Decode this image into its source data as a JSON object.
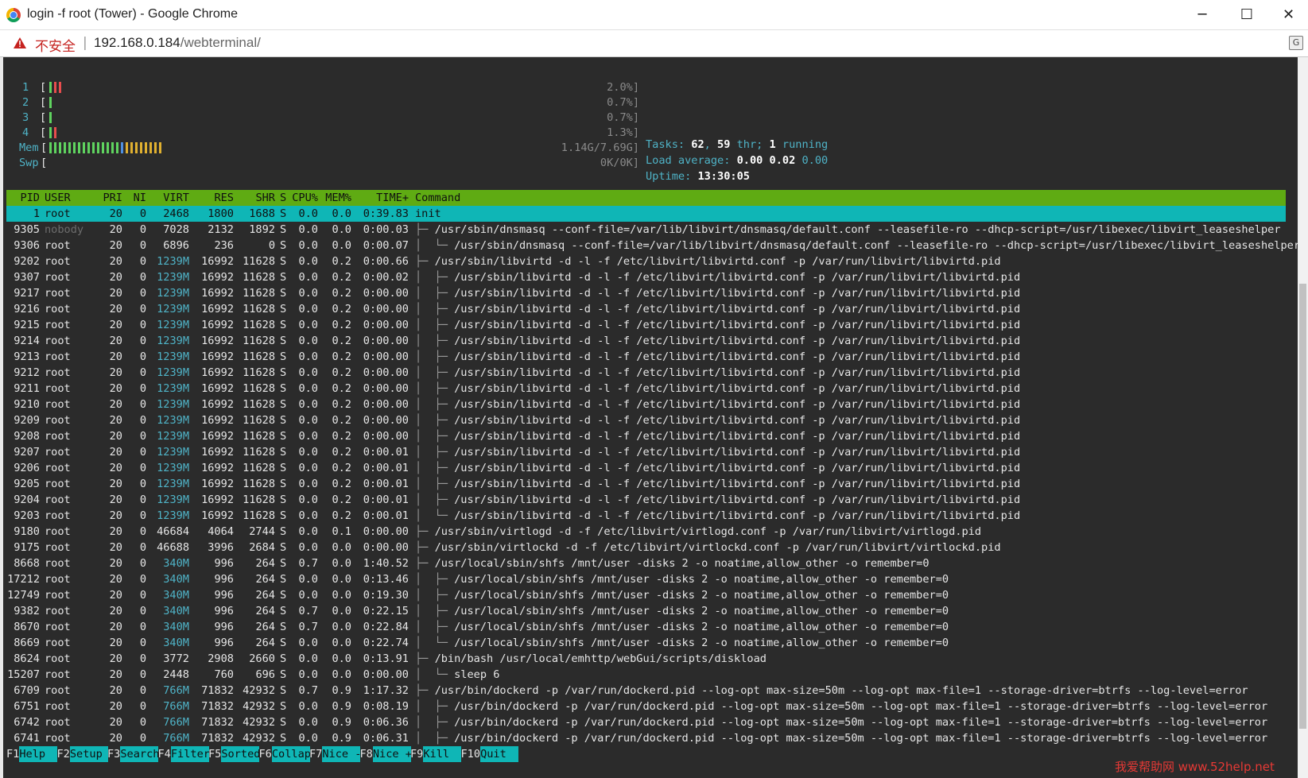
{
  "window": {
    "title": "login -f root (Tower) - Google Chrome",
    "min_glyph": "─",
    "max_glyph": "☐",
    "close_glyph": "✕"
  },
  "address": {
    "security_label": "不安全",
    "separator": "|",
    "host": "192.168.0.184",
    "path": "/webterminal/"
  },
  "translate_icon": "icon-translate",
  "meters": [
    {
      "label": "1",
      "value": "2.0%]",
      "segments": [
        "#5fd35f",
        "#e84d4d",
        "#e84d4d"
      ]
    },
    {
      "label": "2",
      "value": "0.7%]",
      "segments": [
        "#5fd35f"
      ]
    },
    {
      "label": "3",
      "value": "0.7%]",
      "segments": [
        "#5fd35f"
      ]
    },
    {
      "label": "4",
      "value": "1.3%]",
      "segments": [
        "#5fd35f",
        "#e84d4d"
      ]
    },
    {
      "label": "Mem",
      "value": "1.14G/7.69G]",
      "segments": [
        "#5fd35f",
        "#5fd35f",
        "#5fd35f",
        "#5fd35f",
        "#5fd35f",
        "#5fd35f",
        "#5fd35f",
        "#5fd35f",
        "#5fd35f",
        "#5fd35f",
        "#5fd35f",
        "#5fd35f",
        "#5fd35f",
        "#5fd35f",
        "#5fd35f",
        "#4f8fe0",
        "#e0b030",
        "#e0b030",
        "#e0b030",
        "#e0b030",
        "#e0b030",
        "#e0b030",
        "#e0b030",
        "#e0b030"
      ]
    },
    {
      "label": "Swp",
      "value": "0K/0K]",
      "segments": []
    }
  ],
  "summary": {
    "tasks_label": "Tasks:",
    "tasks": "62",
    "thr": "59",
    "thr_label": "thr;",
    "running": "1",
    "running_label": "running",
    "load_label": "Load average:",
    "load1": "0.00",
    "load5": "0.02",
    "load15": "0.00",
    "uptime_label": "Uptime:",
    "uptime": "13:30:05"
  },
  "header": {
    "pid": "PID",
    "user": "USER",
    "pri": "PRI",
    "ni": "NI",
    "virt": "VIRT",
    "res": "RES",
    "shr": "SHR",
    "s": "S",
    "cpu": "CPU%",
    "mem": "MEM%",
    "time": "TIME+",
    "cmd": "Command"
  },
  "processes": [
    {
      "pid": "1",
      "user": "root",
      "pri": "20",
      "ni": "0",
      "virt": "2468",
      "res": "1800",
      "shr": "1688",
      "s": "S",
      "cpu": "0.0",
      "mem": "0.0",
      "time": "0:39.83",
      "tree": "",
      "cmd": "init",
      "selected": true
    },
    {
      "pid": "9305",
      "user": "nobody",
      "pri": "20",
      "ni": "0",
      "virt": "7028",
      "res": "2132",
      "shr": "1892",
      "s": "S",
      "cpu": "0.0",
      "mem": "0.0",
      "time": "0:00.03",
      "tree": "├─ ",
      "cmd": "/usr/sbin/dnsmasq --conf-file=/var/lib/libvirt/dnsmasq/default.conf --leasefile-ro --dhcp-script=/usr/libexec/libvirt_leaseshelper"
    },
    {
      "pid": "9306",
      "user": "root",
      "pri": "20",
      "ni": "0",
      "virt": "6896",
      "res": "236",
      "shr": "0",
      "s": "S",
      "cpu": "0.0",
      "mem": "0.0",
      "time": "0:00.07",
      "tree": "│  └─ ",
      "cmd": "/usr/sbin/dnsmasq --conf-file=/var/lib/libvirt/dnsmasq/default.conf --leasefile-ro --dhcp-script=/usr/libexec/libvirt_leaseshelper"
    },
    {
      "pid": "9202",
      "user": "root",
      "pri": "20",
      "ni": "0",
      "virt": "1239M",
      "res": "16992",
      "shr": "11628",
      "s": "S",
      "cpu": "0.0",
      "mem": "0.2",
      "time": "0:00.66",
      "tree": "├─ ",
      "cmd": "/usr/sbin/libvirtd -d -l -f /etc/libvirt/libvirtd.conf -p /var/run/libvirt/libvirtd.pid"
    },
    {
      "pid": "9307",
      "user": "root",
      "pri": "20",
      "ni": "0",
      "virt": "1239M",
      "res": "16992",
      "shr": "11628",
      "s": "S",
      "cpu": "0.0",
      "mem": "0.2",
      "time": "0:00.02",
      "tree": "│  ├─ ",
      "cmd": "/usr/sbin/libvirtd -d -l -f /etc/libvirt/libvirtd.conf -p /var/run/libvirt/libvirtd.pid"
    },
    {
      "pid": "9217",
      "user": "root",
      "pri": "20",
      "ni": "0",
      "virt": "1239M",
      "res": "16992",
      "shr": "11628",
      "s": "S",
      "cpu": "0.0",
      "mem": "0.2",
      "time": "0:00.00",
      "tree": "│  ├─ ",
      "cmd": "/usr/sbin/libvirtd -d -l -f /etc/libvirt/libvirtd.conf -p /var/run/libvirt/libvirtd.pid"
    },
    {
      "pid": "9216",
      "user": "root",
      "pri": "20",
      "ni": "0",
      "virt": "1239M",
      "res": "16992",
      "shr": "11628",
      "s": "S",
      "cpu": "0.0",
      "mem": "0.2",
      "time": "0:00.00",
      "tree": "│  ├─ ",
      "cmd": "/usr/sbin/libvirtd -d -l -f /etc/libvirt/libvirtd.conf -p /var/run/libvirt/libvirtd.pid"
    },
    {
      "pid": "9215",
      "user": "root",
      "pri": "20",
      "ni": "0",
      "virt": "1239M",
      "res": "16992",
      "shr": "11628",
      "s": "S",
      "cpu": "0.0",
      "mem": "0.2",
      "time": "0:00.00",
      "tree": "│  ├─ ",
      "cmd": "/usr/sbin/libvirtd -d -l -f /etc/libvirt/libvirtd.conf -p /var/run/libvirt/libvirtd.pid"
    },
    {
      "pid": "9214",
      "user": "root",
      "pri": "20",
      "ni": "0",
      "virt": "1239M",
      "res": "16992",
      "shr": "11628",
      "s": "S",
      "cpu": "0.0",
      "mem": "0.2",
      "time": "0:00.00",
      "tree": "│  ├─ ",
      "cmd": "/usr/sbin/libvirtd -d -l -f /etc/libvirt/libvirtd.conf -p /var/run/libvirt/libvirtd.pid"
    },
    {
      "pid": "9213",
      "user": "root",
      "pri": "20",
      "ni": "0",
      "virt": "1239M",
      "res": "16992",
      "shr": "11628",
      "s": "S",
      "cpu": "0.0",
      "mem": "0.2",
      "time": "0:00.00",
      "tree": "│  ├─ ",
      "cmd": "/usr/sbin/libvirtd -d -l -f /etc/libvirt/libvirtd.conf -p /var/run/libvirt/libvirtd.pid"
    },
    {
      "pid": "9212",
      "user": "root",
      "pri": "20",
      "ni": "0",
      "virt": "1239M",
      "res": "16992",
      "shr": "11628",
      "s": "S",
      "cpu": "0.0",
      "mem": "0.2",
      "time": "0:00.00",
      "tree": "│  ├─ ",
      "cmd": "/usr/sbin/libvirtd -d -l -f /etc/libvirt/libvirtd.conf -p /var/run/libvirt/libvirtd.pid"
    },
    {
      "pid": "9211",
      "user": "root",
      "pri": "20",
      "ni": "0",
      "virt": "1239M",
      "res": "16992",
      "shr": "11628",
      "s": "S",
      "cpu": "0.0",
      "mem": "0.2",
      "time": "0:00.00",
      "tree": "│  ├─ ",
      "cmd": "/usr/sbin/libvirtd -d -l -f /etc/libvirt/libvirtd.conf -p /var/run/libvirt/libvirtd.pid"
    },
    {
      "pid": "9210",
      "user": "root",
      "pri": "20",
      "ni": "0",
      "virt": "1239M",
      "res": "16992",
      "shr": "11628",
      "s": "S",
      "cpu": "0.0",
      "mem": "0.2",
      "time": "0:00.00",
      "tree": "│  ├─ ",
      "cmd": "/usr/sbin/libvirtd -d -l -f /etc/libvirt/libvirtd.conf -p /var/run/libvirt/libvirtd.pid"
    },
    {
      "pid": "9209",
      "user": "root",
      "pri": "20",
      "ni": "0",
      "virt": "1239M",
      "res": "16992",
      "shr": "11628",
      "s": "S",
      "cpu": "0.0",
      "mem": "0.2",
      "time": "0:00.00",
      "tree": "│  ├─ ",
      "cmd": "/usr/sbin/libvirtd -d -l -f /etc/libvirt/libvirtd.conf -p /var/run/libvirt/libvirtd.pid"
    },
    {
      "pid": "9208",
      "user": "root",
      "pri": "20",
      "ni": "0",
      "virt": "1239M",
      "res": "16992",
      "shr": "11628",
      "s": "S",
      "cpu": "0.0",
      "mem": "0.2",
      "time": "0:00.00",
      "tree": "│  ├─ ",
      "cmd": "/usr/sbin/libvirtd -d -l -f /etc/libvirt/libvirtd.conf -p /var/run/libvirt/libvirtd.pid"
    },
    {
      "pid": "9207",
      "user": "root",
      "pri": "20",
      "ni": "0",
      "virt": "1239M",
      "res": "16992",
      "shr": "11628",
      "s": "S",
      "cpu": "0.0",
      "mem": "0.2",
      "time": "0:00.01",
      "tree": "│  ├─ ",
      "cmd": "/usr/sbin/libvirtd -d -l -f /etc/libvirt/libvirtd.conf -p /var/run/libvirt/libvirtd.pid"
    },
    {
      "pid": "9206",
      "user": "root",
      "pri": "20",
      "ni": "0",
      "virt": "1239M",
      "res": "16992",
      "shr": "11628",
      "s": "S",
      "cpu": "0.0",
      "mem": "0.2",
      "time": "0:00.01",
      "tree": "│  ├─ ",
      "cmd": "/usr/sbin/libvirtd -d -l -f /etc/libvirt/libvirtd.conf -p /var/run/libvirt/libvirtd.pid"
    },
    {
      "pid": "9205",
      "user": "root",
      "pri": "20",
      "ni": "0",
      "virt": "1239M",
      "res": "16992",
      "shr": "11628",
      "s": "S",
      "cpu": "0.0",
      "mem": "0.2",
      "time": "0:00.01",
      "tree": "│  ├─ ",
      "cmd": "/usr/sbin/libvirtd -d -l -f /etc/libvirt/libvirtd.conf -p /var/run/libvirt/libvirtd.pid"
    },
    {
      "pid": "9204",
      "user": "root",
      "pri": "20",
      "ni": "0",
      "virt": "1239M",
      "res": "16992",
      "shr": "11628",
      "s": "S",
      "cpu": "0.0",
      "mem": "0.2",
      "time": "0:00.01",
      "tree": "│  ├─ ",
      "cmd": "/usr/sbin/libvirtd -d -l -f /etc/libvirt/libvirtd.conf -p /var/run/libvirt/libvirtd.pid"
    },
    {
      "pid": "9203",
      "user": "root",
      "pri": "20",
      "ni": "0",
      "virt": "1239M",
      "res": "16992",
      "shr": "11628",
      "s": "S",
      "cpu": "0.0",
      "mem": "0.2",
      "time": "0:00.01",
      "tree": "│  └─ ",
      "cmd": "/usr/sbin/libvirtd -d -l -f /etc/libvirt/libvirtd.conf -p /var/run/libvirt/libvirtd.pid"
    },
    {
      "pid": "9180",
      "user": "root",
      "pri": "20",
      "ni": "0",
      "virt": "46684",
      "res": "4064",
      "shr": "2744",
      "s": "S",
      "cpu": "0.0",
      "mem": "0.1",
      "time": "0:00.00",
      "tree": "├─ ",
      "cmd": "/usr/sbin/virtlogd -d -f /etc/libvirt/virtlogd.conf -p /var/run/libvirt/virtlogd.pid"
    },
    {
      "pid": "9175",
      "user": "root",
      "pri": "20",
      "ni": "0",
      "virt": "46688",
      "res": "3996",
      "shr": "2684",
      "s": "S",
      "cpu": "0.0",
      "mem": "0.0",
      "time": "0:00.00",
      "tree": "├─ ",
      "cmd": "/usr/sbin/virtlockd -d -f /etc/libvirt/virtlockd.conf -p /var/run/libvirt/virtlockd.pid"
    },
    {
      "pid": "8668",
      "user": "root",
      "pri": "20",
      "ni": "0",
      "virt": "340M",
      "res": "996",
      "shr": "264",
      "s": "S",
      "cpu": "0.7",
      "mem": "0.0",
      "time": "1:40.52",
      "tree": "├─ ",
      "cmd": "/usr/local/sbin/shfs /mnt/user -disks 2 -o noatime,allow_other -o remember=0"
    },
    {
      "pid": "17212",
      "user": "root",
      "pri": "20",
      "ni": "0",
      "virt": "340M",
      "res": "996",
      "shr": "264",
      "s": "S",
      "cpu": "0.0",
      "mem": "0.0",
      "time": "0:13.46",
      "tree": "│  ├─ ",
      "cmd": "/usr/local/sbin/shfs /mnt/user -disks 2 -o noatime,allow_other -o remember=0"
    },
    {
      "pid": "12749",
      "user": "root",
      "pri": "20",
      "ni": "0",
      "virt": "340M",
      "res": "996",
      "shr": "264",
      "s": "S",
      "cpu": "0.0",
      "mem": "0.0",
      "time": "0:19.30",
      "tree": "│  ├─ ",
      "cmd": "/usr/local/sbin/shfs /mnt/user -disks 2 -o noatime,allow_other -o remember=0"
    },
    {
      "pid": "9382",
      "user": "root",
      "pri": "20",
      "ni": "0",
      "virt": "340M",
      "res": "996",
      "shr": "264",
      "s": "S",
      "cpu": "0.7",
      "mem": "0.0",
      "time": "0:22.15",
      "tree": "│  ├─ ",
      "cmd": "/usr/local/sbin/shfs /mnt/user -disks 2 -o noatime,allow_other -o remember=0"
    },
    {
      "pid": "8670",
      "user": "root",
      "pri": "20",
      "ni": "0",
      "virt": "340M",
      "res": "996",
      "shr": "264",
      "s": "S",
      "cpu": "0.7",
      "mem": "0.0",
      "time": "0:22.84",
      "tree": "│  ├─ ",
      "cmd": "/usr/local/sbin/shfs /mnt/user -disks 2 -o noatime,allow_other -o remember=0"
    },
    {
      "pid": "8669",
      "user": "root",
      "pri": "20",
      "ni": "0",
      "virt": "340M",
      "res": "996",
      "shr": "264",
      "s": "S",
      "cpu": "0.0",
      "mem": "0.0",
      "time": "0:22.74",
      "tree": "│  └─ ",
      "cmd": "/usr/local/sbin/shfs /mnt/user -disks 2 -o noatime,allow_other -o remember=0"
    },
    {
      "pid": "8624",
      "user": "root",
      "pri": "20",
      "ni": "0",
      "virt": "3772",
      "res": "2908",
      "shr": "2660",
      "s": "S",
      "cpu": "0.0",
      "mem": "0.0",
      "time": "0:13.91",
      "tree": "├─ ",
      "cmd": "/bin/bash /usr/local/emhttp/webGui/scripts/diskload"
    },
    {
      "pid": "15207",
      "user": "root",
      "pri": "20",
      "ni": "0",
      "virt": "2448",
      "res": "760",
      "shr": "696",
      "s": "S",
      "cpu": "0.0",
      "mem": "0.0",
      "time": "0:00.00",
      "tree": "│  └─ ",
      "cmd": "sleep 6"
    },
    {
      "pid": "6709",
      "user": "root",
      "pri": "20",
      "ni": "0",
      "virt": "766M",
      "res": "71832",
      "shr": "42932",
      "s": "S",
      "cpu": "0.7",
      "mem": "0.9",
      "time": "1:17.32",
      "tree": "├─ ",
      "cmd": "/usr/bin/dockerd -p /var/run/dockerd.pid --log-opt max-size=50m --log-opt max-file=1 --storage-driver=btrfs --log-level=error"
    },
    {
      "pid": "6751",
      "user": "root",
      "pri": "20",
      "ni": "0",
      "virt": "766M",
      "res": "71832",
      "shr": "42932",
      "s": "S",
      "cpu": "0.0",
      "mem": "0.9",
      "time": "0:08.19",
      "tree": "│  ├─ ",
      "cmd": "/usr/bin/dockerd -p /var/run/dockerd.pid --log-opt max-size=50m --log-opt max-file=1 --storage-driver=btrfs --log-level=error"
    },
    {
      "pid": "6742",
      "user": "root",
      "pri": "20",
      "ni": "0",
      "virt": "766M",
      "res": "71832",
      "shr": "42932",
      "s": "S",
      "cpu": "0.0",
      "mem": "0.9",
      "time": "0:06.36",
      "tree": "│  ├─ ",
      "cmd": "/usr/bin/dockerd -p /var/run/dockerd.pid --log-opt max-size=50m --log-opt max-file=1 --storage-driver=btrfs --log-level=error"
    },
    {
      "pid": "6741",
      "user": "root",
      "pri": "20",
      "ni": "0",
      "virt": "766M",
      "res": "71832",
      "shr": "42932",
      "s": "S",
      "cpu": "0.0",
      "mem": "0.9",
      "time": "0:06.31",
      "tree": "│  ├─ ",
      "cmd": "/usr/bin/dockerd -p /var/run/dockerd.pid --log-opt max-size=50m --log-opt max-file=1 --storage-driver=btrfs --log-level=error"
    }
  ],
  "fkeys": [
    {
      "key": "F1",
      "label": "Help"
    },
    {
      "key": "F2",
      "label": "Setup"
    },
    {
      "key": "F3",
      "label": "Search"
    },
    {
      "key": "F4",
      "label": "Filter"
    },
    {
      "key": "F5",
      "label": "Sorted"
    },
    {
      "key": "F6",
      "label": "Collap"
    },
    {
      "key": "F7",
      "label": "Nice -"
    },
    {
      "key": "F8",
      "label": "Nice +"
    },
    {
      "key": "F9",
      "label": "Kill"
    },
    {
      "key": "F10",
      "label": "Quit"
    }
  ],
  "watermark": "我爱帮助网 www.52help.net",
  "colors": {
    "header_bg": "#5fab13",
    "selected_bg": "#0fb6b6",
    "label_cyan": "#4fb3c7",
    "terminal_bg": "#2b2b2b"
  }
}
